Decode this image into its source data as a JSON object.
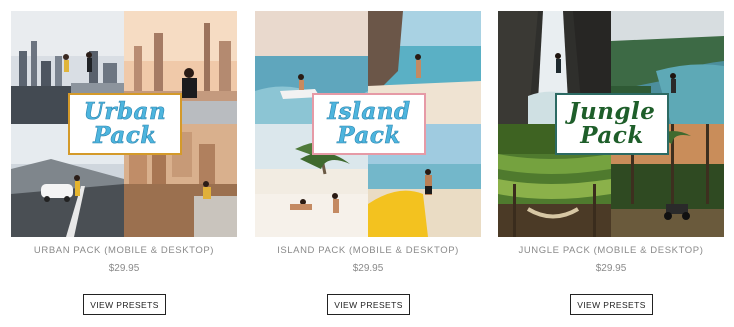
{
  "products": [
    {
      "badge_line1": "Urban",
      "badge_line2": "Pack",
      "title": "URBAN PACK (MOBILE & DESKTOP)",
      "price": "$29.95",
      "button_label": "VIEW PRESETS",
      "accent": "#d49a2a"
    },
    {
      "badge_line1": "Island",
      "badge_line2": "Pack",
      "title": "ISLAND PACK (MOBILE & DESKTOP)",
      "price": "$29.95",
      "button_label": "VIEW PRESETS",
      "accent": "#e69aa6"
    },
    {
      "badge_line1": "Jungle",
      "badge_line2": "Pack",
      "title": "JUNGLE PACK (MOBILE & DESKTOP)",
      "price": "$29.95",
      "button_label": "VIEW PRESETS",
      "accent": "#2c6a63"
    }
  ]
}
